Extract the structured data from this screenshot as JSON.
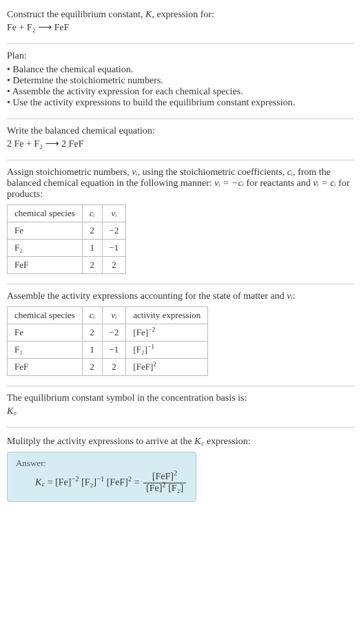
{
  "intro": {
    "line1": "Construct the equilibrium constant, K, expression for:",
    "equation": "Fe + F₂ ⟶ FeF"
  },
  "plan": {
    "heading": "Plan:",
    "items": [
      "Balance the chemical equation.",
      "Determine the stoichiometric numbers.",
      "Assemble the activity expression for each chemical species.",
      "Use the activity expressions to build the equilibrium constant expression."
    ]
  },
  "balanced": {
    "heading": "Write the balanced chemical equation:",
    "equation": "2 Fe + F₂ ⟶ 2 FeF"
  },
  "stoich": {
    "text_a": "Assign stoichiometric numbers, ",
    "nu": "νᵢ",
    "text_b": ", using the stoichiometric coefficients, ",
    "ci": "cᵢ",
    "text_c": ", from the balanced chemical equation in the following manner: ",
    "rel1": "νᵢ = −cᵢ",
    "text_d": " for reactants and ",
    "rel2": "νᵢ = cᵢ",
    "text_e": " for products:",
    "head_species": "chemical species",
    "head_ci": "cᵢ",
    "head_nu": "νᵢ",
    "rows": [
      {
        "sp": "Fe",
        "ci": "2",
        "nu": "−2"
      },
      {
        "sp": "F₂",
        "ci": "1",
        "nu": "−1"
      },
      {
        "sp": "FeF",
        "ci": "2",
        "nu": "2"
      }
    ]
  },
  "activity": {
    "heading_a": "Assemble the activity expressions accounting for the state of matter and ",
    "nu": "νᵢ",
    "heading_b": ":",
    "head_species": "chemical species",
    "head_ci": "cᵢ",
    "head_nu": "νᵢ",
    "head_act": "activity expression",
    "rows": [
      {
        "sp": "Fe",
        "ci": "2",
        "nu": "−2",
        "act_base": "[Fe]",
        "act_exp": "−2"
      },
      {
        "sp": "F₂",
        "ci": "1",
        "nu": "−1",
        "act_base": "[F₂]",
        "act_exp": "−1"
      },
      {
        "sp": "FeF",
        "ci": "2",
        "nu": "2",
        "act_base": "[FeF]",
        "act_exp": "2"
      }
    ]
  },
  "symbol": {
    "heading": "The equilibrium constant symbol in the concentration basis is:",
    "kc": "K꜀"
  },
  "multiply": {
    "heading_a": "Mulitply the activity expressions to arrive at the ",
    "kc": "K꜀",
    "heading_b": " expression:"
  },
  "answer": {
    "label": "Answer:",
    "kc": "K꜀",
    "eq": " = ",
    "t1b": "[Fe]",
    "t1e": "−2",
    "t2b": "[F₂]",
    "t2e": "−1",
    "t3b": "[FeF]",
    "t3e": "2",
    "eq2": " = ",
    "num_b": "[FeF]",
    "num_e": "2",
    "den1_b": "[Fe]",
    "den1_e": "2",
    "den2_b": "[F₂]"
  }
}
